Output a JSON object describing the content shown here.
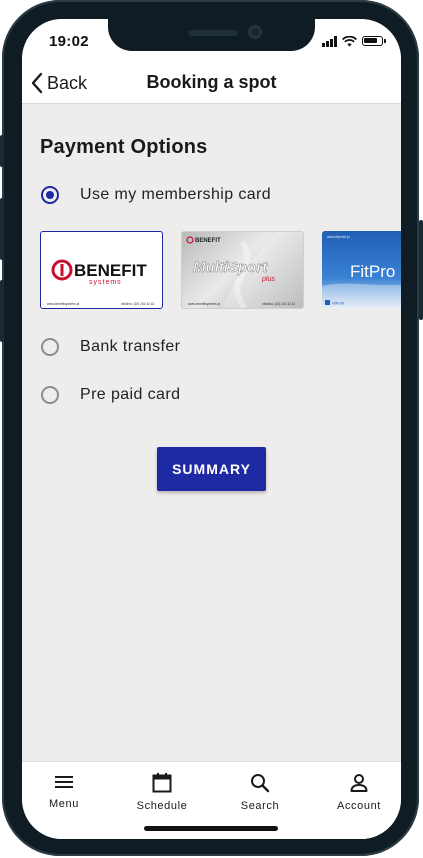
{
  "status_bar": {
    "time": "19:02"
  },
  "navbar": {
    "back_label": "Back",
    "title": "Booking a spot"
  },
  "payment": {
    "title": "Payment Options",
    "options": [
      {
        "label": "Use my membership card",
        "selected": true
      },
      {
        "label": "Bank transfer",
        "selected": false
      },
      {
        "label": "Pre paid card",
        "selected": false
      }
    ],
    "cards": [
      {
        "logo": "BENEFIT",
        "sub": "systems",
        "footer_left": "www.benefitsystems.pl",
        "footer_right": "infolinia: (22) 242 42 42"
      },
      {
        "brand_top": "BENEFIT",
        "logo": "MultiSport",
        "tag": "plus",
        "footer_left": "www.benefitsystems.pl",
        "footer_right": "infolinia: (22) 242 42 42"
      },
      {
        "header": "www.fitprofit.pl",
        "logo": "FitPro",
        "footer": "FitProfit"
      }
    ]
  },
  "summary_button": {
    "label": "SUMMARY"
  },
  "tabbar": {
    "items": [
      {
        "label": "Menu",
        "icon": "menu-icon"
      },
      {
        "label": "Schedule",
        "icon": "calendar-icon"
      },
      {
        "label": "Search",
        "icon": "search-icon"
      },
      {
        "label": "Account",
        "icon": "account-icon"
      }
    ]
  },
  "colors": {
    "accent": "#1e2aa3",
    "background": "#efedec",
    "frame": "#0f1c24"
  }
}
